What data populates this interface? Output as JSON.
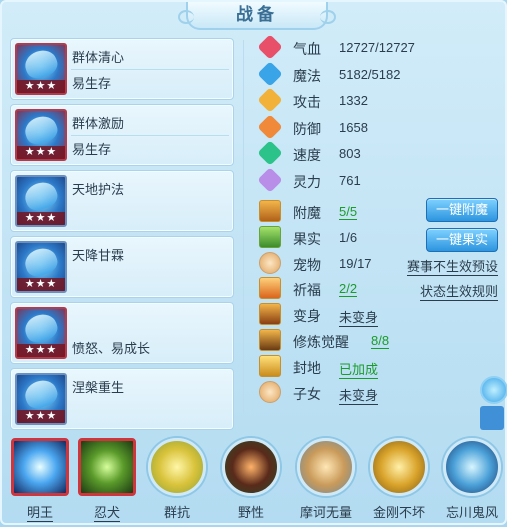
{
  "window": {
    "title": "战备"
  },
  "skills": [
    {
      "name": "群体清心",
      "desc": "易生存",
      "stars": "★★★",
      "icon": "blade-skill-icon"
    },
    {
      "name": "群体激励",
      "desc": "易生存",
      "stars": "★★★",
      "icon": "lance-skill-icon"
    },
    {
      "name": "天地护法",
      "desc": "",
      "stars": "★★★",
      "icon": "shield-skill-icon"
    },
    {
      "name": "天降甘霖",
      "desc": "",
      "stars": "★★★",
      "icon": "rain-skill-icon"
    },
    {
      "name": "",
      "desc": "愤怒、易成长",
      "stars": "★★★",
      "icon": "rage-skill-icon"
    },
    {
      "name": "涅槃重生",
      "desc": "",
      "stars": "★★★",
      "icon": "rebirth-skill-icon"
    }
  ],
  "stats": [
    {
      "label": "气血",
      "value": "12727/12727",
      "color": "#e8506a"
    },
    {
      "label": "魔法",
      "value": "5182/5182",
      "color": "#3aa4e8"
    },
    {
      "label": "攻击",
      "value": "1332",
      "color": "#f2b23a"
    },
    {
      "label": "防御",
      "value": "1658",
      "color": "#f08a3a"
    },
    {
      "label": "速度",
      "value": "803",
      "color": "#2cc38a"
    },
    {
      "label": "灵力",
      "value": "761",
      "color": "#b98ee8"
    }
  ],
  "items": {
    "fumo": {
      "label": "附魔",
      "value": "5/5",
      "button": "一键附魔"
    },
    "guoshi": {
      "label": "果实",
      "value": "1/6",
      "button": "一键果实"
    },
    "chongwu": {
      "label": "宠物",
      "value": "19/17",
      "link": "赛事不生效预设"
    },
    "qifu": {
      "label": "祈福",
      "value": "2/2",
      "link": "状态生效规则"
    },
    "bianshen": {
      "label": "变身",
      "value": "未变身"
    },
    "xiulian": {
      "label": "修炼觉醒",
      "value": "8/8"
    },
    "fengdi": {
      "label": "封地",
      "value": "已加成"
    },
    "zinv": {
      "label": "子女",
      "value": "未变身"
    }
  },
  "pets": [
    {
      "name": "明王",
      "icon": "mingwang-pet-icon"
    },
    {
      "name": "忍犬",
      "icon": "renquan-pet-icon"
    },
    {
      "name": "群抗",
      "icon": "qunkang-pet-icon"
    },
    {
      "name": "野性",
      "icon": "yexing-pet-icon"
    },
    {
      "name": "摩诃无量",
      "icon": "mohe-pet-icon"
    },
    {
      "name": "金刚不坏",
      "icon": "jingang-pet-icon"
    },
    {
      "name": "忘川鬼风",
      "icon": "wangchuan-pet-icon"
    }
  ]
}
